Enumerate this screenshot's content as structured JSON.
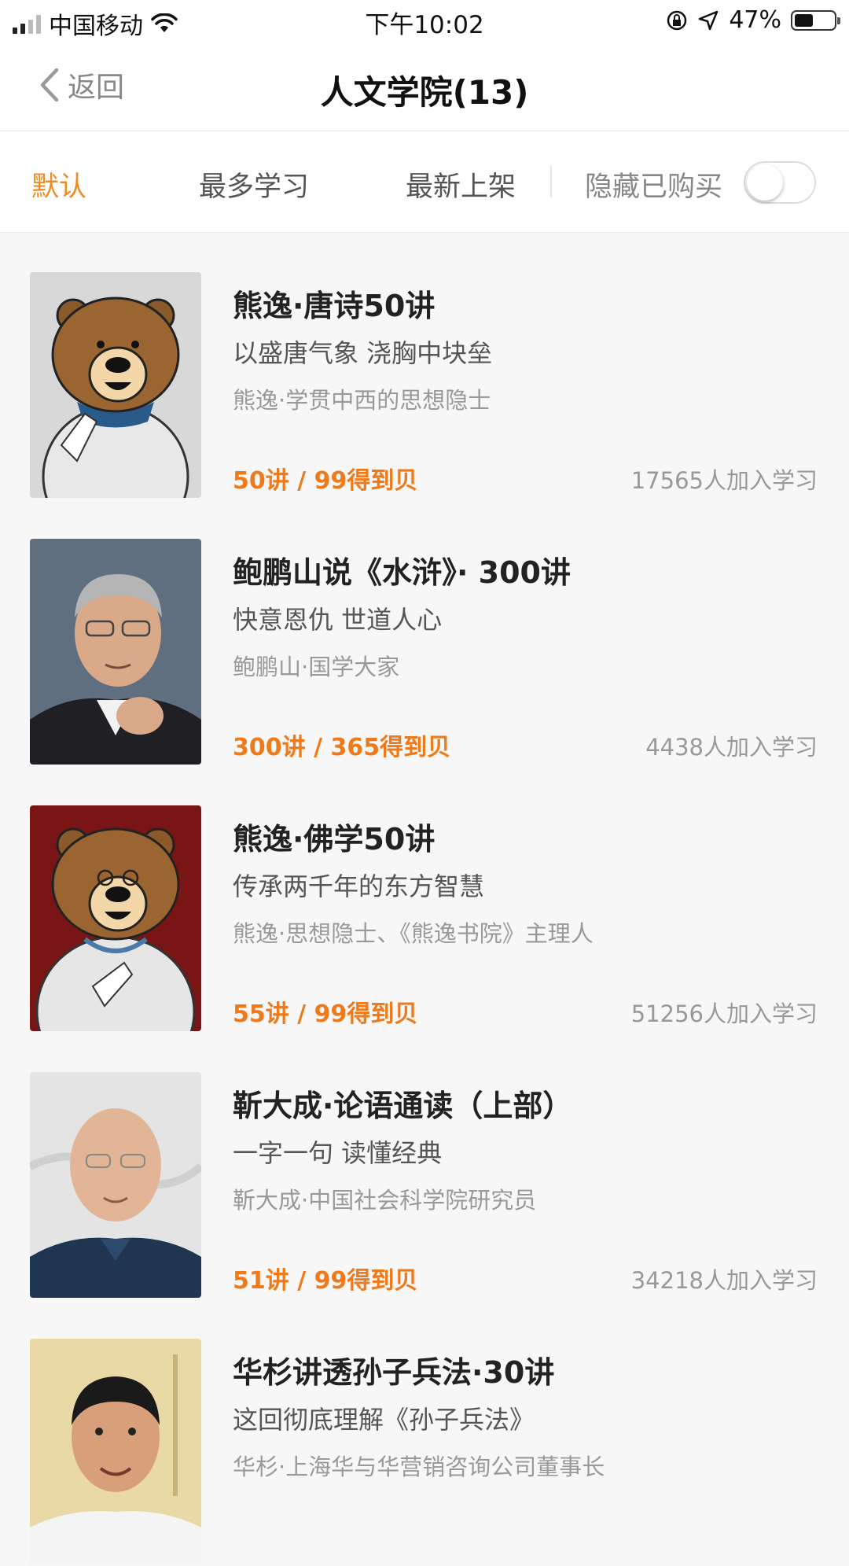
{
  "status_bar": {
    "carrier": "中国移动",
    "time": "下午10:02",
    "battery_pct": "47%",
    "battery_level": 0.47
  },
  "nav": {
    "back_label": "返回",
    "title": "人文学院(13)"
  },
  "filters": {
    "tabs": [
      {
        "label": "默认",
        "active": true
      },
      {
        "label": "最多学习",
        "active": false
      },
      {
        "label": "最新上架",
        "active": false
      }
    ],
    "hide_purchased_label": "隐藏已购买",
    "hide_purchased_on": false
  },
  "colors": {
    "accent": "#f08a24",
    "price": "#f07a1a"
  },
  "courses": [
    {
      "title": "熊逸·唐诗50讲",
      "subtitle": "以盛唐气象 浇胸中块垒",
      "author": "熊逸·学贯中西的思想隐士",
      "price": "50讲 / 99得到贝",
      "learners": "17565人加入学习",
      "cover": "bear-illustration-gray"
    },
    {
      "title": "鲍鹏山说《水浒》· 300讲",
      "subtitle": "快意恩仇 世道人心",
      "author": "鲍鹏山·国学大家",
      "price": "300讲 / 365得到贝",
      "learners": "4438人加入学习",
      "cover": "portrait-man-glasses"
    },
    {
      "title": "熊逸·佛学50讲",
      "subtitle": "传承两千年的东方智慧",
      "author": "熊逸·思想隐士、《熊逸书院》主理人",
      "price": "55讲 / 99得到贝",
      "learners": "51256人加入学习",
      "cover": "bear-illustration-red"
    },
    {
      "title": "靳大成·论语通读（上部）",
      "subtitle": "一字一句 读懂经典",
      "author": "靳大成·中国社会科学院研究员",
      "price": "51讲 / 99得到贝",
      "learners": "34218人加入学习",
      "cover": "portrait-bald-man"
    },
    {
      "title": "华杉讲透孙子兵法·30讲",
      "subtitle": "这回彻底理解《孙子兵法》",
      "author": "华杉·上海华与华营销咨询公司董事长",
      "price": "",
      "learners": "",
      "cover": "portrait-man-smiling"
    }
  ]
}
